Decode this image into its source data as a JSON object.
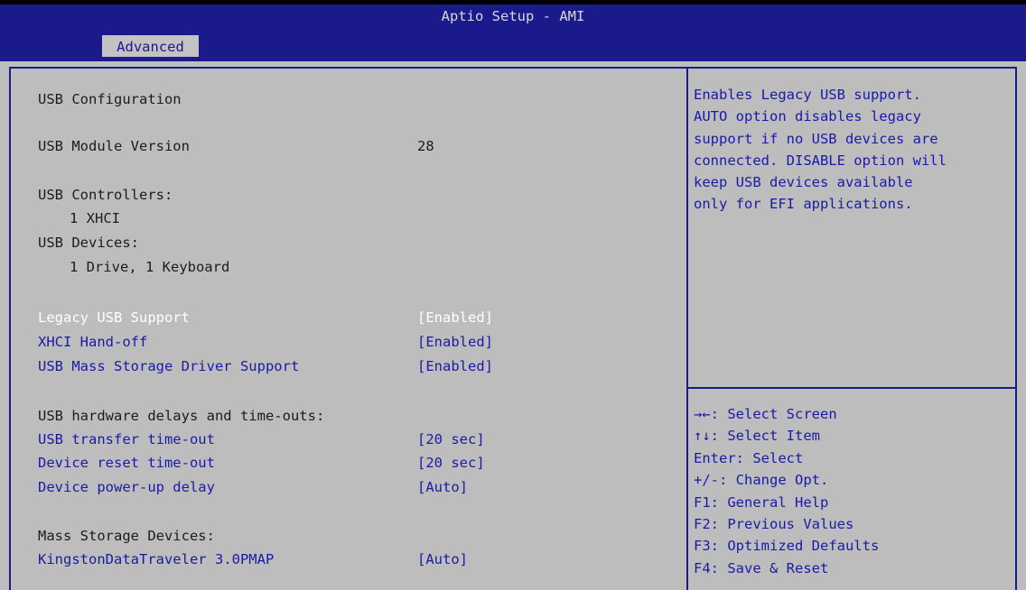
{
  "window": {
    "title": "Aptio Setup - AMI"
  },
  "tabs": [
    {
      "label": "Advanced",
      "active": true
    }
  ],
  "colors": {
    "header_bg": "#1a1a8c",
    "panel_bg": "#bdbdbd",
    "link": "#1a1aa8",
    "selected": "#ffffff"
  },
  "main": {
    "section_title": "USB Configuration",
    "module_version": {
      "label": "USB Module Version",
      "value": "28"
    },
    "controllers_label": "USB Controllers:",
    "controllers_value": "1 XHCI",
    "devices_label": "USB Devices:",
    "devices_value": "1 Drive, 1 Keyboard",
    "legacy_usb": {
      "label": "Legacy USB Support",
      "value": "[Enabled]",
      "selected": true
    },
    "xhci_handoff": {
      "label": "XHCI Hand-off",
      "value": "[Enabled]"
    },
    "mass_storage_driver": {
      "label": "USB Mass Storage Driver Support",
      "value": "[Enabled]"
    },
    "delays_header": "USB hardware delays and time-outs:",
    "transfer_timeout": {
      "label": "USB transfer time-out",
      "value": "[20 sec]"
    },
    "reset_timeout": {
      "label": "Device reset time-out",
      "value": "[20 sec]"
    },
    "powerup_delay": {
      "label": "Device power-up delay",
      "value": "[Auto]"
    },
    "mass_storage_header": "Mass Storage Devices:",
    "kingston": {
      "label": "KingstonDataTraveler 3.0PMAP",
      "value": "[Auto]"
    }
  },
  "help": {
    "lines": [
      "Enables Legacy USB support.",
      "AUTO option disables legacy",
      "support if no USB devices are",
      "connected. DISABLE option will",
      "keep USB devices available",
      "only for EFI applications."
    ]
  },
  "keys": [
    {
      "key": "→←",
      "desc": ": Select Screen",
      "icon": "arrow-left-right-icon"
    },
    {
      "key": "↑↓",
      "desc": ": Select Item",
      "icon": "arrow-up-down-icon"
    },
    {
      "key": "Enter",
      "desc": ": Select"
    },
    {
      "key": "+/-",
      "desc": ": Change Opt."
    },
    {
      "key": "F1",
      "desc": ": General Help"
    },
    {
      "key": "F2",
      "desc": ": Previous Values"
    },
    {
      "key": "F3",
      "desc": ": Optimized Defaults"
    },
    {
      "key": "F4",
      "desc": ": Save & Reset"
    }
  ]
}
